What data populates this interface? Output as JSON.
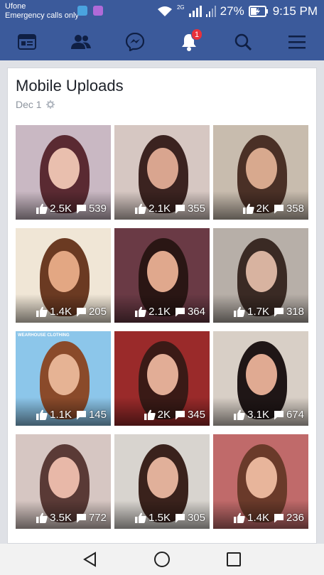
{
  "status_bar": {
    "carrier": "Ufone",
    "emergency": "Emergency calls only",
    "network": "2G",
    "battery": "27%",
    "time": "9:15 PM"
  },
  "app_nav": {
    "items": [
      "news-feed-icon",
      "friends-icon",
      "messenger-icon",
      "notifications-icon",
      "search-icon",
      "menu-icon"
    ],
    "notification_count": "1"
  },
  "album": {
    "title": "Mobile Uploads",
    "date": "Dec 1",
    "photos": [
      {
        "likes": "2.5K",
        "comments": "539"
      },
      {
        "likes": "2.1K",
        "comments": "355"
      },
      {
        "likes": "2K",
        "comments": "358"
      },
      {
        "likes": "1.4K",
        "comments": "205"
      },
      {
        "likes": "2.1K",
        "comments": "364"
      },
      {
        "likes": "1.7K",
        "comments": "318"
      },
      {
        "likes": "1.1K",
        "comments": "145"
      },
      {
        "likes": "2K",
        "comments": "345"
      },
      {
        "likes": "3.1K",
        "comments": "674"
      },
      {
        "likes": "3.5K",
        "comments": "772"
      },
      {
        "likes": "1.5K",
        "comments": "305"
      },
      {
        "likes": "1.4K",
        "comments": "236"
      }
    ],
    "watermark": "WEARHOUSE CLOTHING"
  },
  "colors": {
    "brand": "#3b5a9b",
    "badge": "#e8313b"
  }
}
